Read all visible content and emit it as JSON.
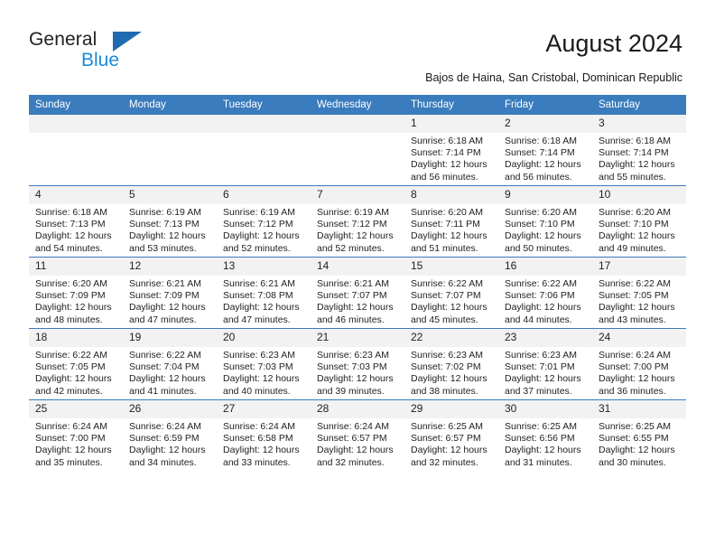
{
  "brand": {
    "name_part1": "General",
    "name_part2": "Blue",
    "logo_icon": "triangle-icon",
    "accent_blue": "#1c8ad6",
    "triangle_blue": "#1f6bb0"
  },
  "header": {
    "title": "August 2024",
    "subtitle": "Bajos de Haina, San Cristobal, Dominican Republic"
  },
  "calendar": {
    "header_bg": "#3a7cbe",
    "daynum_bg": "#f2f2f2",
    "weekday_headers": [
      "Sunday",
      "Monday",
      "Tuesday",
      "Wednesday",
      "Thursday",
      "Friday",
      "Saturday"
    ],
    "weeks": [
      [
        {
          "day": "",
          "sunrise": "",
          "sunset": "",
          "daylight_line1": "",
          "daylight_line2": "",
          "empty": true
        },
        {
          "day": "",
          "sunrise": "",
          "sunset": "",
          "daylight_line1": "",
          "daylight_line2": "",
          "empty": true
        },
        {
          "day": "",
          "sunrise": "",
          "sunset": "",
          "daylight_line1": "",
          "daylight_line2": "",
          "empty": true
        },
        {
          "day": "",
          "sunrise": "",
          "sunset": "",
          "daylight_line1": "",
          "daylight_line2": "",
          "empty": true
        },
        {
          "day": "1",
          "sunrise": "Sunrise: 6:18 AM",
          "sunset": "Sunset: 7:14 PM",
          "daylight_line1": "Daylight: 12 hours",
          "daylight_line2": "and 56 minutes.",
          "empty": false
        },
        {
          "day": "2",
          "sunrise": "Sunrise: 6:18 AM",
          "sunset": "Sunset: 7:14 PM",
          "daylight_line1": "Daylight: 12 hours",
          "daylight_line2": "and 56 minutes.",
          "empty": false
        },
        {
          "day": "3",
          "sunrise": "Sunrise: 6:18 AM",
          "sunset": "Sunset: 7:14 PM",
          "daylight_line1": "Daylight: 12 hours",
          "daylight_line2": "and 55 minutes.",
          "empty": false
        }
      ],
      [
        {
          "day": "4",
          "sunrise": "Sunrise: 6:18 AM",
          "sunset": "Sunset: 7:13 PM",
          "daylight_line1": "Daylight: 12 hours",
          "daylight_line2": "and 54 minutes.",
          "empty": false
        },
        {
          "day": "5",
          "sunrise": "Sunrise: 6:19 AM",
          "sunset": "Sunset: 7:13 PM",
          "daylight_line1": "Daylight: 12 hours",
          "daylight_line2": "and 53 minutes.",
          "empty": false
        },
        {
          "day": "6",
          "sunrise": "Sunrise: 6:19 AM",
          "sunset": "Sunset: 7:12 PM",
          "daylight_line1": "Daylight: 12 hours",
          "daylight_line2": "and 52 minutes.",
          "empty": false
        },
        {
          "day": "7",
          "sunrise": "Sunrise: 6:19 AM",
          "sunset": "Sunset: 7:12 PM",
          "daylight_line1": "Daylight: 12 hours",
          "daylight_line2": "and 52 minutes.",
          "empty": false
        },
        {
          "day": "8",
          "sunrise": "Sunrise: 6:20 AM",
          "sunset": "Sunset: 7:11 PM",
          "daylight_line1": "Daylight: 12 hours",
          "daylight_line2": "and 51 minutes.",
          "empty": false
        },
        {
          "day": "9",
          "sunrise": "Sunrise: 6:20 AM",
          "sunset": "Sunset: 7:10 PM",
          "daylight_line1": "Daylight: 12 hours",
          "daylight_line2": "and 50 minutes.",
          "empty": false
        },
        {
          "day": "10",
          "sunrise": "Sunrise: 6:20 AM",
          "sunset": "Sunset: 7:10 PM",
          "daylight_line1": "Daylight: 12 hours",
          "daylight_line2": "and 49 minutes.",
          "empty": false
        }
      ],
      [
        {
          "day": "11",
          "sunrise": "Sunrise: 6:20 AM",
          "sunset": "Sunset: 7:09 PM",
          "daylight_line1": "Daylight: 12 hours",
          "daylight_line2": "and 48 minutes.",
          "empty": false
        },
        {
          "day": "12",
          "sunrise": "Sunrise: 6:21 AM",
          "sunset": "Sunset: 7:09 PM",
          "daylight_line1": "Daylight: 12 hours",
          "daylight_line2": "and 47 minutes.",
          "empty": false
        },
        {
          "day": "13",
          "sunrise": "Sunrise: 6:21 AM",
          "sunset": "Sunset: 7:08 PM",
          "daylight_line1": "Daylight: 12 hours",
          "daylight_line2": "and 47 minutes.",
          "empty": false
        },
        {
          "day": "14",
          "sunrise": "Sunrise: 6:21 AM",
          "sunset": "Sunset: 7:07 PM",
          "daylight_line1": "Daylight: 12 hours",
          "daylight_line2": "and 46 minutes.",
          "empty": false
        },
        {
          "day": "15",
          "sunrise": "Sunrise: 6:22 AM",
          "sunset": "Sunset: 7:07 PM",
          "daylight_line1": "Daylight: 12 hours",
          "daylight_line2": "and 45 minutes.",
          "empty": false
        },
        {
          "day": "16",
          "sunrise": "Sunrise: 6:22 AM",
          "sunset": "Sunset: 7:06 PM",
          "daylight_line1": "Daylight: 12 hours",
          "daylight_line2": "and 44 minutes.",
          "empty": false
        },
        {
          "day": "17",
          "sunrise": "Sunrise: 6:22 AM",
          "sunset": "Sunset: 7:05 PM",
          "daylight_line1": "Daylight: 12 hours",
          "daylight_line2": "and 43 minutes.",
          "empty": false
        }
      ],
      [
        {
          "day": "18",
          "sunrise": "Sunrise: 6:22 AM",
          "sunset": "Sunset: 7:05 PM",
          "daylight_line1": "Daylight: 12 hours",
          "daylight_line2": "and 42 minutes.",
          "empty": false
        },
        {
          "day": "19",
          "sunrise": "Sunrise: 6:22 AM",
          "sunset": "Sunset: 7:04 PM",
          "daylight_line1": "Daylight: 12 hours",
          "daylight_line2": "and 41 minutes.",
          "empty": false
        },
        {
          "day": "20",
          "sunrise": "Sunrise: 6:23 AM",
          "sunset": "Sunset: 7:03 PM",
          "daylight_line1": "Daylight: 12 hours",
          "daylight_line2": "and 40 minutes.",
          "empty": false
        },
        {
          "day": "21",
          "sunrise": "Sunrise: 6:23 AM",
          "sunset": "Sunset: 7:03 PM",
          "daylight_line1": "Daylight: 12 hours",
          "daylight_line2": "and 39 minutes.",
          "empty": false
        },
        {
          "day": "22",
          "sunrise": "Sunrise: 6:23 AM",
          "sunset": "Sunset: 7:02 PM",
          "daylight_line1": "Daylight: 12 hours",
          "daylight_line2": "and 38 minutes.",
          "empty": false
        },
        {
          "day": "23",
          "sunrise": "Sunrise: 6:23 AM",
          "sunset": "Sunset: 7:01 PM",
          "daylight_line1": "Daylight: 12 hours",
          "daylight_line2": "and 37 minutes.",
          "empty": false
        },
        {
          "day": "24",
          "sunrise": "Sunrise: 6:24 AM",
          "sunset": "Sunset: 7:00 PM",
          "daylight_line1": "Daylight: 12 hours",
          "daylight_line2": "and 36 minutes.",
          "empty": false
        }
      ],
      [
        {
          "day": "25",
          "sunrise": "Sunrise: 6:24 AM",
          "sunset": "Sunset: 7:00 PM",
          "daylight_line1": "Daylight: 12 hours",
          "daylight_line2": "and 35 minutes.",
          "empty": false
        },
        {
          "day": "26",
          "sunrise": "Sunrise: 6:24 AM",
          "sunset": "Sunset: 6:59 PM",
          "daylight_line1": "Daylight: 12 hours",
          "daylight_line2": "and 34 minutes.",
          "empty": false
        },
        {
          "day": "27",
          "sunrise": "Sunrise: 6:24 AM",
          "sunset": "Sunset: 6:58 PM",
          "daylight_line1": "Daylight: 12 hours",
          "daylight_line2": "and 33 minutes.",
          "empty": false
        },
        {
          "day": "28",
          "sunrise": "Sunrise: 6:24 AM",
          "sunset": "Sunset: 6:57 PM",
          "daylight_line1": "Daylight: 12 hours",
          "daylight_line2": "and 32 minutes.",
          "empty": false
        },
        {
          "day": "29",
          "sunrise": "Sunrise: 6:25 AM",
          "sunset": "Sunset: 6:57 PM",
          "daylight_line1": "Daylight: 12 hours",
          "daylight_line2": "and 32 minutes.",
          "empty": false
        },
        {
          "day": "30",
          "sunrise": "Sunrise: 6:25 AM",
          "sunset": "Sunset: 6:56 PM",
          "daylight_line1": "Daylight: 12 hours",
          "daylight_line2": "and 31 minutes.",
          "empty": false
        },
        {
          "day": "31",
          "sunrise": "Sunrise: 6:25 AM",
          "sunset": "Sunset: 6:55 PM",
          "daylight_line1": "Daylight: 12 hours",
          "daylight_line2": "and 30 minutes.",
          "empty": false
        }
      ]
    ]
  }
}
